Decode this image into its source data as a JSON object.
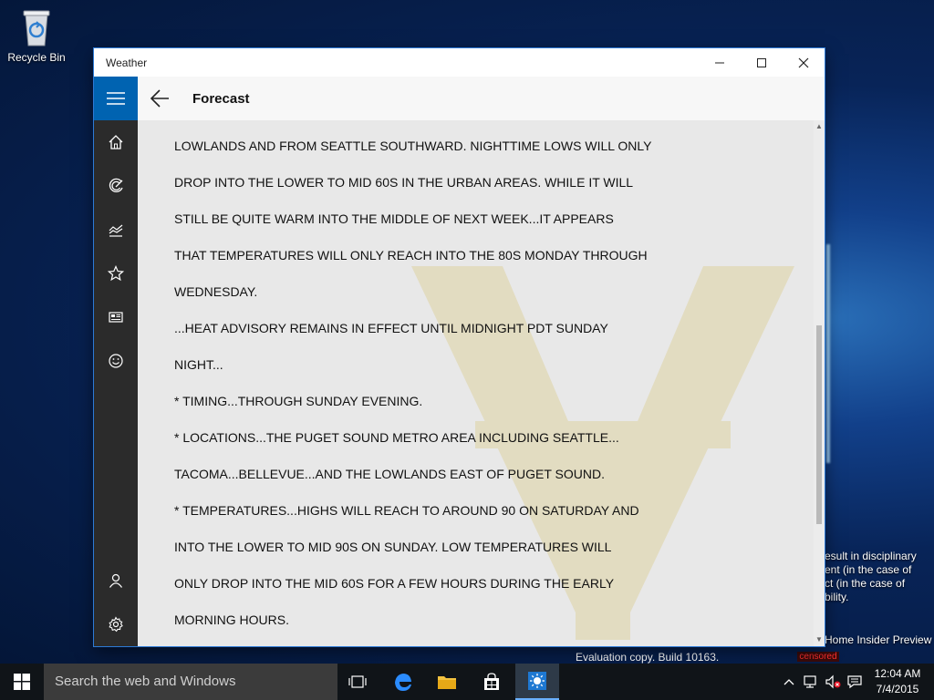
{
  "desktop": {
    "recycle_bin_label": "Recycle Bin",
    "side_text": [
      "esult in disciplinary",
      "ent (in the case of",
      "ct (in the case of",
      "bility."
    ],
    "insider_text": "Home Insider Preview",
    "evaluation_text": "Evaluation copy. Build 10163.",
    "censored_label": "censored"
  },
  "window": {
    "title": "Weather",
    "page_title": "Forecast"
  },
  "forecast_lines": [
    "LOWLANDS AND FROM SEATTLE SOUTHWARD. NIGHTTIME LOWS WILL ONLY",
    "DROP INTO THE LOWER TO MID 60S IN THE URBAN AREAS. WHILE IT WILL",
    "STILL BE QUITE WARM INTO THE MIDDLE OF NEXT WEEK...IT APPEARS",
    "THAT TEMPERATURES WILL ONLY REACH INTO THE 80S MONDAY THROUGH",
    "WEDNESDAY.",
    "...HEAT ADVISORY REMAINS IN EFFECT UNTIL MIDNIGHT PDT SUNDAY",
    "NIGHT...",
    "* TIMING...THROUGH SUNDAY EVENING.",
    "* LOCATIONS...THE PUGET SOUND METRO AREA INCLUDING SEATTLE...",
    "TACOMA...BELLEVUE...AND THE LOWLANDS EAST OF PUGET SOUND.",
    "* TEMPERATURES...HIGHS WILL REACH TO AROUND 90 ON SATURDAY AND",
    "INTO THE LOWER TO MID 90S ON SUNDAY. LOW TEMPERATURES WILL",
    "ONLY DROP INTO THE MID 60S FOR A FEW HOURS DURING THE EARLY",
    "MORNING HOURS."
  ],
  "nav_icons": [
    "home-icon",
    "radar-icon",
    "chart-icon",
    "star-icon",
    "news-icon",
    "smiley-icon",
    "person-icon",
    "gear-icon"
  ],
  "taskbar": {
    "search_placeholder": "Search the web and Windows",
    "time": "12:04 AM",
    "date": "7/4/2015"
  },
  "colors": {
    "accent": "#0063b1",
    "nav_background": "#2b2b2b",
    "taskbar": "#101418"
  }
}
